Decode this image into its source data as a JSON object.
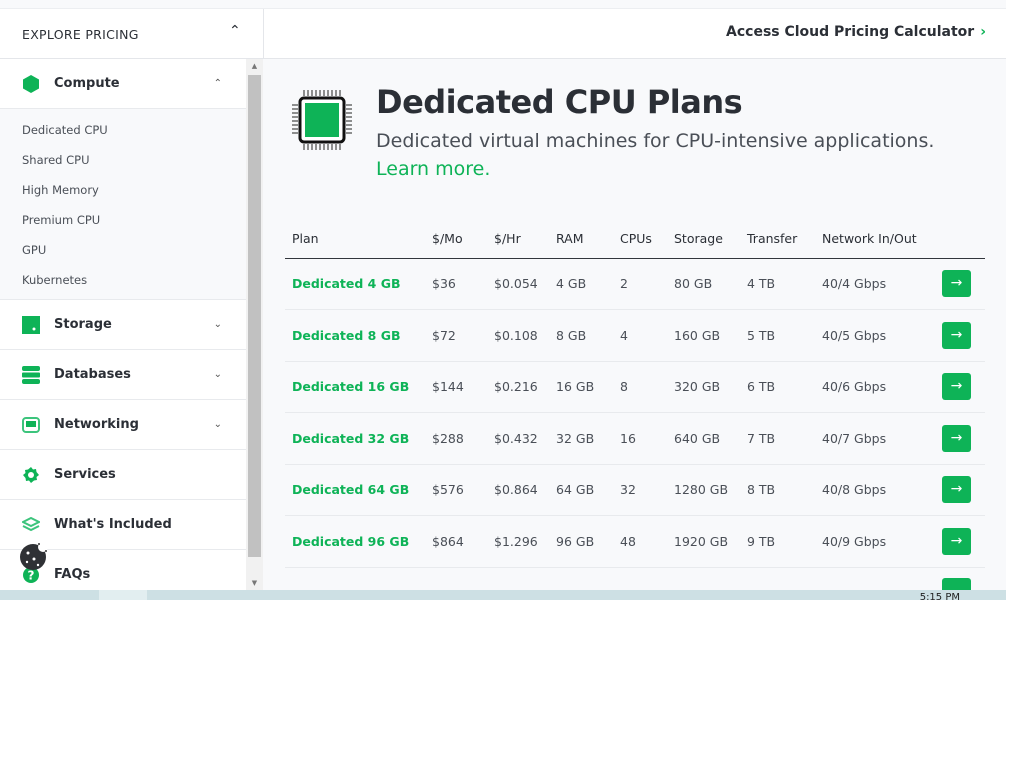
{
  "header": {
    "explore_label": "EXPLORE PRICING",
    "calculator_link": "Access Cloud Pricing Calculator"
  },
  "sidebar": {
    "categories": [
      {
        "label": "Compute",
        "icon": "hexagon-icon",
        "expanded": true,
        "items": [
          "Dedicated CPU",
          "Shared CPU",
          "High Memory",
          "Premium CPU",
          "GPU",
          "Kubernetes"
        ]
      },
      {
        "label": "Storage",
        "icon": "storage-icon"
      },
      {
        "label": "Databases",
        "icon": "database-icon"
      },
      {
        "label": "Networking",
        "icon": "ethernet-icon"
      },
      {
        "label": "Services",
        "icon": "gear-icon"
      },
      {
        "label": "What's Included",
        "icon": "box-icon"
      },
      {
        "label": "FAQs",
        "icon": "question-icon"
      }
    ]
  },
  "main": {
    "title": "Dedicated CPU Plans",
    "description": "Dedicated virtual machines for CPU-intensive applications.",
    "learn_more": "Learn more.",
    "columns": [
      "Plan",
      "$/Mo",
      "$/Hr",
      "RAM",
      "CPUs",
      "Storage",
      "Transfer",
      "Network In/Out"
    ],
    "rows": [
      [
        "Dedicated 4 GB",
        "$36",
        "$0.054",
        "4 GB",
        "2",
        "80 GB",
        "4 TB",
        "40/4 Gbps"
      ],
      [
        "Dedicated 8 GB",
        "$72",
        "$0.108",
        "8 GB",
        "4",
        "160 GB",
        "5 TB",
        "40/5 Gbps"
      ],
      [
        "Dedicated 16 GB",
        "$144",
        "$0.216",
        "16 GB",
        "8",
        "320 GB",
        "6 TB",
        "40/6 Gbps"
      ],
      [
        "Dedicated 32 GB",
        "$288",
        "$0.432",
        "32 GB",
        "16",
        "640 GB",
        "7 TB",
        "40/7 Gbps"
      ],
      [
        "Dedicated 64 GB",
        "$576",
        "$0.864",
        "64 GB",
        "32",
        "1280 GB",
        "8 TB",
        "40/8 Gbps"
      ],
      [
        "Dedicated 96 GB",
        "$864",
        "$1.296",
        "96 GB",
        "48",
        "1920 GB",
        "9 TB",
        "40/9 Gbps"
      ]
    ],
    "row_button": "→"
  },
  "taskbar": {
    "clock": "5:15 PM"
  },
  "colors": {
    "accent": "#0eb357",
    "text": "#32363c"
  }
}
